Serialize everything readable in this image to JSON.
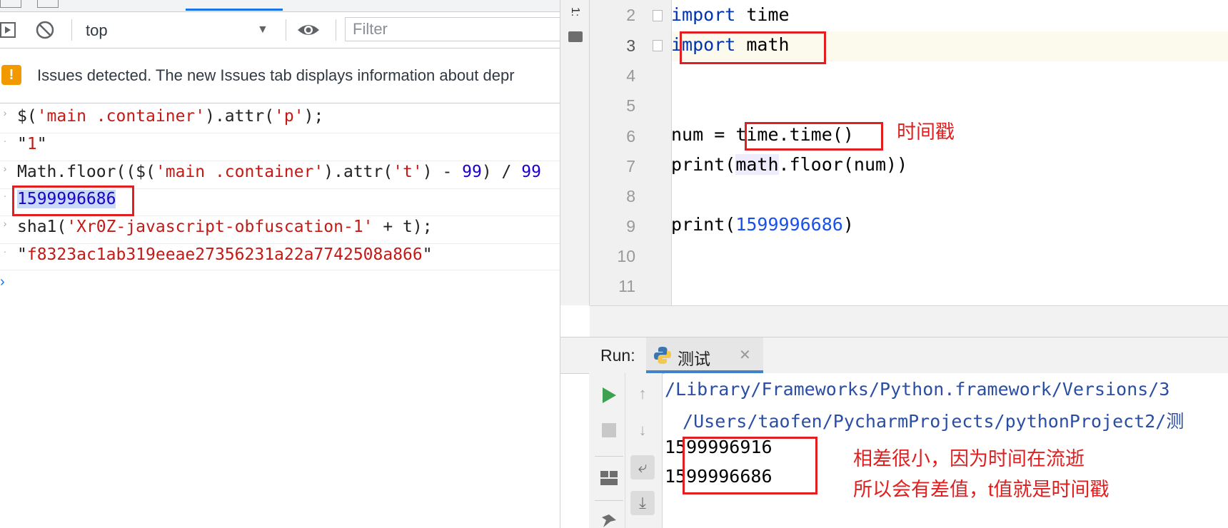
{
  "devtools": {
    "context_selector": "top",
    "filter_placeholder": "Filter",
    "issues_banner": "Issues detected. The new Issues tab displays information about depr",
    "console": {
      "line1": {
        "pre": "$(",
        "s1": "'main .container'",
        "mid": ").attr(",
        "s2": "'p'",
        "post": ");"
      },
      "result1": {
        "q1": "\"",
        "val": "1",
        "q2": "\""
      },
      "line2": {
        "pre": "Math.floor(($(",
        "s1": "'main .container'",
        "mid": ").attr(",
        "s2": "'t'",
        "mid2": ") - ",
        "n1": "99",
        "mid3": ") / ",
        "n2": "99"
      },
      "result2": "1599996686",
      "line3": {
        "pre": "sha1(",
        "s1": "'Xr0Z-javascript-obfuscation-1'",
        "post": " + t);"
      },
      "result3": {
        "q1": "\"",
        "val": "f8323ac1ab319eeae27356231a22a7742508a866",
        "q2": "\""
      }
    }
  },
  "pycharm": {
    "project_tool_label": "1:",
    "line_numbers": [
      "2",
      "3",
      "4",
      "5",
      "6",
      "7",
      "8",
      "9",
      "10",
      "11"
    ],
    "code": {
      "l2_kw": "import",
      "l2_rest": " time",
      "l3_kw": "import",
      "l3_rest": " math",
      "l6_a": "num = ",
      "l6_b": "time.time()",
      "l7_a": "print(",
      "l7_b": "math",
      "l7_c": ".floor(num))",
      "l9_a": "print(",
      "l9_num": "1599996686",
      "l9_c": ")"
    },
    "annotations": {
      "timestamp": "时间戳",
      "diff_line1": "相差很小，因为时间在流逝",
      "diff_line2": "所以会有差值，t值就是时间戳"
    },
    "run": {
      "label": "Run:",
      "tab_label": "测试",
      "output": [
        "/Library/Frameworks/Python.framework/Versions/3",
        " /Users/taofen/PycharmProjects/pythonProject2/测",
        "1599996916",
        "1599996686"
      ]
    }
  }
}
